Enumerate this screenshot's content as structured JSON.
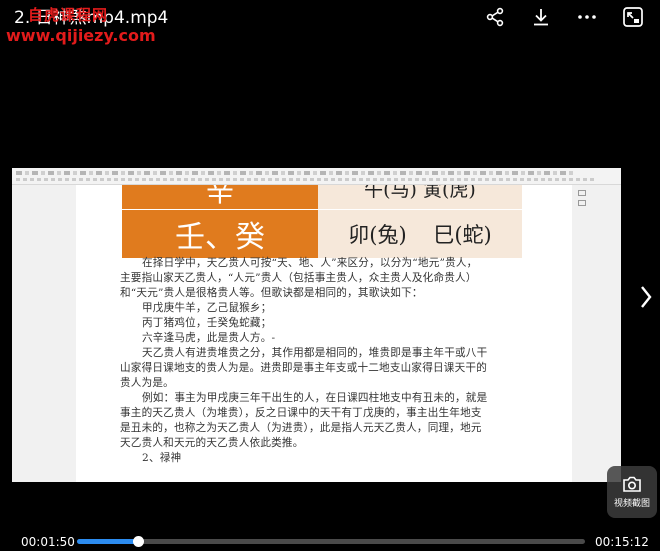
{
  "header": {
    "title": "2.  日神煞mp4.mp4",
    "watermark_name": "自虎课程网",
    "watermark_url": "www.qijiezy.com"
  },
  "icons": {
    "share": "share-icon",
    "download": "download-icon",
    "more": "more-icon",
    "pip": "picture-in-picture-icon",
    "next": "chevron-right-icon",
    "camera": "camera-icon"
  },
  "document": {
    "table_row1_left": "辛",
    "table_row1_right": "午(马)  寅(虎)",
    "table_row2_left": "壬、癸",
    "table_row2_right": "卯(兔) 巳(蛇)",
    "paragraphs": [
      "在择日学中，天乙贵人可按“天、地、人”来区分，以分为“地元”贵人，",
      "主要指山家天乙贵人，“人元”贵人（包括事主贵人，众主贵人及化命贵人）",
      "和“天元”贵人是很格贵人等。但歌诀都是相同的，其歌诀如下：",
      "甲戊庚牛羊，乙己鼠猴乡；",
      "丙丁猪鸡位，壬癸兔蛇藏；",
      "六辛逢马虎，此是贵人方。-",
      "天乙贵人有进贵堆贵之分，其作用都是相同的，堆贵即是事主年干或八干",
      "山家得日课地支的贵人为是。进贵即是事主年支或十二地支山家得日课天干的",
      "贵人为是。",
      "例如：事主为甲戌庚三年干出生的人，在日课四柱地支中有丑未的，就是",
      "事主的天乙贵人（为堆贵），反之日课中的天干有丁戊庚的，事主出生年地支",
      "是丑未的，也称之为天乙贵人（为进贵），此是指人元天乙贵人，同理，地元",
      "天乙贵人和天元的天乙贵人依此类推。",
      "2、禄神"
    ],
    "indents": [
      1,
      0,
      0,
      1,
      1,
      1,
      1,
      0,
      0,
      1,
      0,
      0,
      0,
      1
    ]
  },
  "controls": {
    "screenshot_label": "视频截图",
    "current_time": "00:01:50",
    "total_time": "00:15:12",
    "progress": 0.121
  }
}
